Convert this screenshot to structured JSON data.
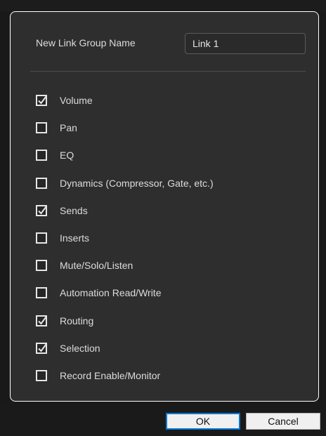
{
  "dialog": {
    "name_label": "New Link Group Name",
    "name_value": "Link 1"
  },
  "options": [
    {
      "label": "Volume",
      "checked": true
    },
    {
      "label": "Pan",
      "checked": false
    },
    {
      "label": "EQ",
      "checked": false
    },
    {
      "label": "Dynamics (Compressor, Gate, etc.)",
      "checked": false
    },
    {
      "label": "Sends",
      "checked": true
    },
    {
      "label": "Inserts",
      "checked": false
    },
    {
      "label": "Mute/Solo/Listen",
      "checked": false
    },
    {
      "label": "Automation Read/Write",
      "checked": false
    },
    {
      "label": "Routing",
      "checked": true
    },
    {
      "label": "Selection",
      "checked": true
    },
    {
      "label": "Record Enable/Monitor",
      "checked": false
    }
  ],
  "buttons": {
    "ok_label": "OK",
    "cancel_label": "Cancel"
  },
  "colors": {
    "panel_bg": "#2e2e2e",
    "panel_border": "#ffffff",
    "default_button_border": "#0078d7"
  },
  "icons": {
    "checked": "checkmark-icon"
  }
}
